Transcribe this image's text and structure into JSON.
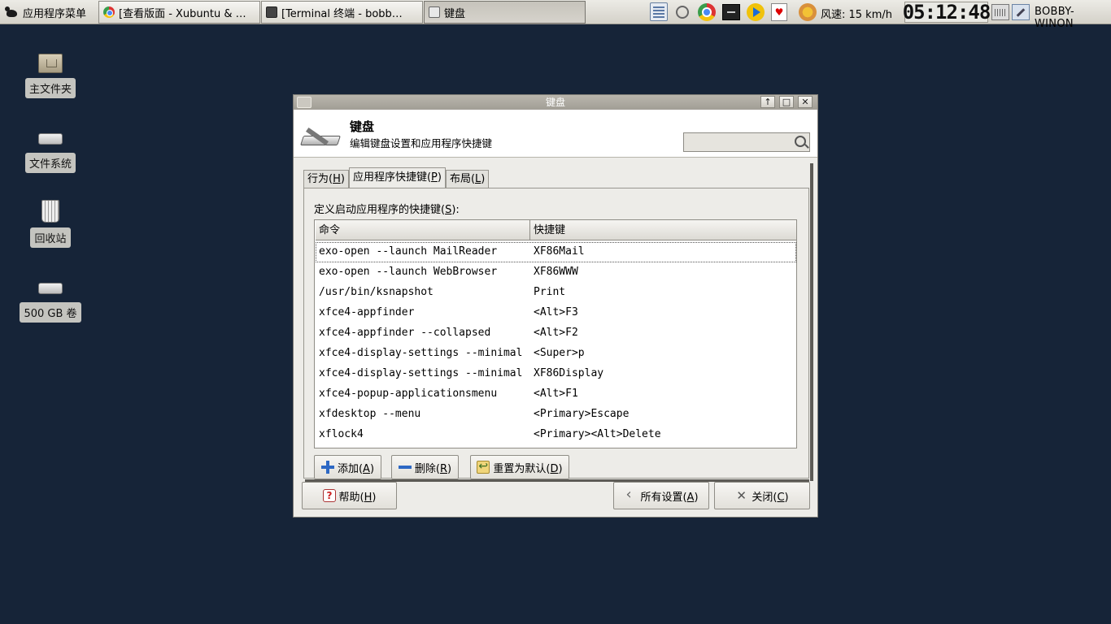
{
  "panel": {
    "app_menu_label": "应用程序菜单",
    "tasks": [
      {
        "label": "[查看版面 - Xubuntu & …",
        "icon": "chrome-icon"
      },
      {
        "label": "[Terminal 终端 - bobb…",
        "icon": "terminal-icon"
      },
      {
        "label": "键盘",
        "icon": "keyboard-icon"
      }
    ],
    "weather": "风速: 15 km/h",
    "clock": "05:12:48",
    "username": "BOBBY-WINON"
  },
  "desktop": {
    "icons": [
      {
        "label": "主文件夹",
        "icon": "home-folder-icon"
      },
      {
        "label": "文件系统",
        "icon": "drive-icon"
      },
      {
        "label": "回收站",
        "icon": "trash-icon"
      },
      {
        "label": "500 GB 卷",
        "icon": "drive-icon"
      }
    ]
  },
  "dialog": {
    "window_title": "键盘",
    "header_title": "键盘",
    "header_subtitle": "编辑键盘设置和应用程序快捷键",
    "search": {
      "value": "",
      "placeholder": ""
    },
    "tabs": [
      {
        "label": "行为(",
        "mnemonic": "H",
        "suffix": ")"
      },
      {
        "label": "应用程序快捷键(",
        "mnemonic": "P",
        "suffix": ")"
      },
      {
        "label": "布局(",
        "mnemonic": "L",
        "suffix": ")"
      }
    ],
    "section_label": {
      "text": "定义启动应用程序的快捷键(",
      "mnemonic": "S",
      "suffix": "):"
    },
    "columns": [
      "命令",
      "快捷键"
    ],
    "rows": [
      {
        "command": "exo-open --launch MailReader",
        "shortcut": "XF86Mail"
      },
      {
        "command": "exo-open --launch WebBrowser",
        "shortcut": "XF86WWW"
      },
      {
        "command": "/usr/bin/ksnapshot",
        "shortcut": "Print"
      },
      {
        "command": "xfce4-appfinder",
        "shortcut": "<Alt>F3"
      },
      {
        "command": "xfce4-appfinder --collapsed",
        "shortcut": "<Alt>F2"
      },
      {
        "command": "xfce4-display-settings --minimal",
        "shortcut": "<Super>p"
      },
      {
        "command": "xfce4-display-settings --minimal",
        "shortcut": "XF86Display"
      },
      {
        "command": "xfce4-popup-applicationsmenu",
        "shortcut": "<Alt>F1"
      },
      {
        "command": "xfdesktop --menu",
        "shortcut": "<Primary>Escape"
      },
      {
        "command": "xflock4",
        "shortcut": "<Primary><Alt>Delete"
      }
    ],
    "buttons": {
      "add": {
        "label": "添加(",
        "mnemonic": "A",
        "suffix": ")"
      },
      "remove": {
        "label": "删除(",
        "mnemonic": "R",
        "suffix": ")"
      },
      "reset": {
        "label": "重置为默认(",
        "mnemonic": "D",
        "suffix": ")"
      },
      "help": {
        "label": "帮助(",
        "mnemonic": "H",
        "suffix": ")"
      },
      "all_settings": {
        "label": "所有设置(",
        "mnemonic": "A",
        "suffix": ")"
      },
      "close": {
        "label": "关闭(",
        "mnemonic": "C",
        "suffix": ")"
      }
    }
  }
}
